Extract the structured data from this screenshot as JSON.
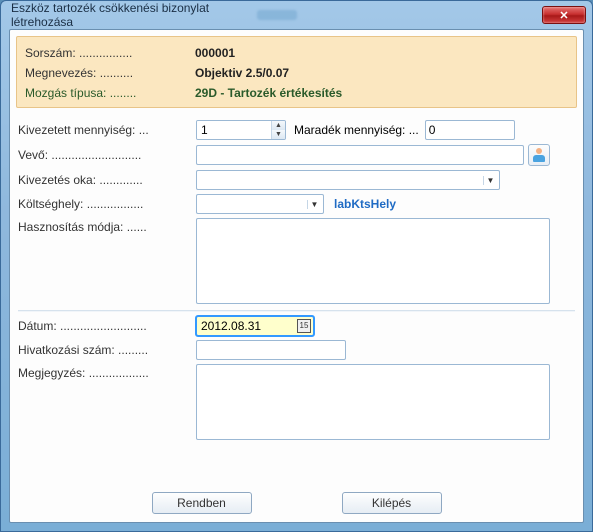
{
  "window": {
    "title": "Eszköz tartozék csökkenési bizonylat létrehozása"
  },
  "header": {
    "serial_label": "Sorszám: ................",
    "serial_value": "000001",
    "name_label": "Megnevezés: ..........",
    "name_value": "Objektiv 2.5/0.07",
    "movetype_label": "Mozgás típusa: ........",
    "movetype_value": "29D - Tartozék értékesítés"
  },
  "form": {
    "qty_out_label": "Kivezetett mennyiség: ...",
    "qty_out_value": "1",
    "remaining_label": "Maradék mennyiség: ...",
    "remaining_value": "0",
    "buyer_label": "Vevő: ...........................",
    "buyer_value": "",
    "reason_label": "Kivezetés oka: .............",
    "reason_value": "",
    "costcenter_label": "Költséghely: .................",
    "costcenter_value": "",
    "costcenter_link": "labKtsHely",
    "usage_label": "Hasznosítás módja: ......",
    "usage_value": "",
    "date_label": "Dátum: ..........................",
    "date_value": "2012.08.31",
    "ref_label": "Hivatkozási szám: .........",
    "ref_value": "",
    "note_label": "Megjegyzés: ..................",
    "note_value": ""
  },
  "footer": {
    "ok_label": "Rendben",
    "cancel_label": "Kilépés"
  }
}
